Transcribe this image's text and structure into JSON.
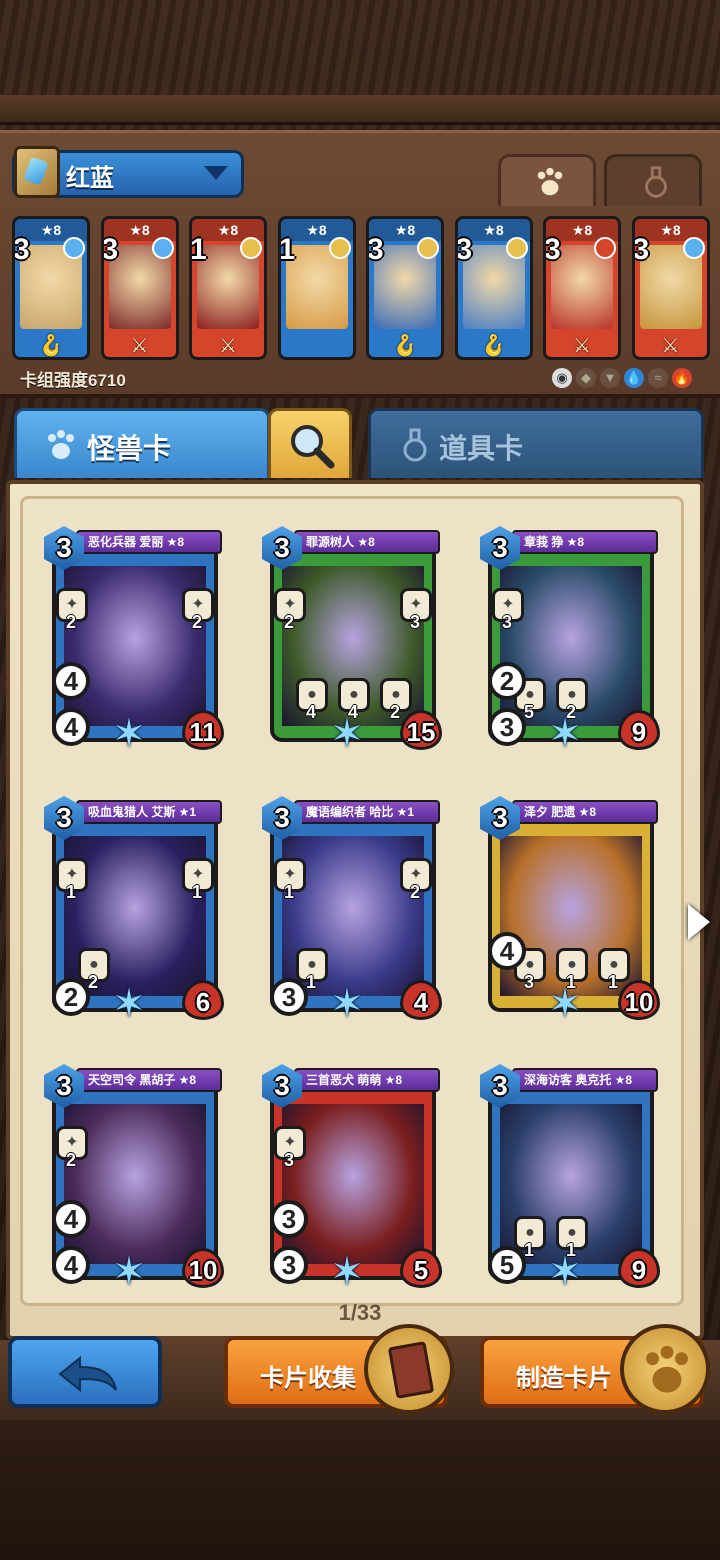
{
  "deck": {
    "name": "红蓝",
    "power_label": "卡组强度6710",
    "cards": [
      {
        "stars": "★8",
        "cost": "3",
        "color": "blue",
        "gem": "#5ab0f0",
        "art": "#c9a56a",
        "weapon": "🪝"
      },
      {
        "stars": "★8",
        "cost": "3",
        "color": "red",
        "gem": "#5ab0f0",
        "art": "#7c2a2a",
        "weapon": "⚔"
      },
      {
        "stars": "★8",
        "cost": "1",
        "color": "red",
        "gem": "#e5c04c",
        "art": "#8b1f1f",
        "weapon": "⚔"
      },
      {
        "stars": "★8",
        "cost": "1",
        "color": "blue",
        "gem": "#e5c04c",
        "art": "#d79a45",
        "weapon": ""
      },
      {
        "stars": "★8",
        "cost": "3",
        "color": "blue",
        "gem": "#e5c04c",
        "art": "#3a6bb8",
        "weapon": "🪝"
      },
      {
        "stars": "★8",
        "cost": "3",
        "color": "blue",
        "gem": "#e5c04c",
        "art": "#4b7ec4",
        "weapon": "🪝"
      },
      {
        "stars": "★8",
        "cost": "3",
        "color": "red",
        "gem": "#d5452c",
        "art": "#b9332a",
        "weapon": "⚔"
      },
      {
        "stars": "★8",
        "cost": "3",
        "color": "red",
        "gem": "#5ab0f0",
        "art": "#c4953a",
        "weapon": "⚔"
      }
    ]
  },
  "tabs": {
    "monster_label": "怪兽卡",
    "item_label": "道具卡"
  },
  "cards": [
    {
      "title": "恶化兵器 爱丽 ★8",
      "cost": "3",
      "dice": "4",
      "atk": "4",
      "hp": "11",
      "frame": "#2f74c0",
      "art": "#3b2a6e",
      "skill_nums": [
        "2",
        "2"
      ],
      "low_nums": []
    },
    {
      "title": "罪源树人 ★8",
      "cost": "3",
      "dice": "",
      "atk": "",
      "hp": "15",
      "frame": "#3b9a3a",
      "art": "#3e5a2a",
      "skill_nums": [
        "2",
        "3"
      ],
      "low_nums": [
        "4",
        "4",
        "2"
      ]
    },
    {
      "title": "章莪 狰 ★8",
      "cost": "3",
      "dice": "2",
      "atk": "3",
      "hp": "9",
      "frame": "#3b9a3a",
      "art": "#2a4b6a",
      "skill_nums": [
        "3"
      ],
      "low_nums": [
        "5",
        "2"
      ]
    },
    {
      "title": "吸血鬼猎人 艾斯 ★1",
      "cost": "3",
      "dice": "",
      "atk": "2",
      "hp": "6",
      "frame": "#2f74c0",
      "art": "#2a2060",
      "skill_nums": [
        "1",
        "1"
      ],
      "low_nums": [
        "2"
      ]
    },
    {
      "title": "魔语编织者 哈比 ★1",
      "cost": "3",
      "dice": "",
      "atk": "3",
      "hp": "4",
      "frame": "#2f74c0",
      "art": "#3a3a8a",
      "skill_nums": [
        "1",
        "2"
      ],
      "low_nums": [
        "1"
      ]
    },
    {
      "title": "泽夕 肥遗 ★8",
      "cost": "3",
      "dice": "4",
      "atk": "",
      "hp": "10",
      "frame": "#d8b035",
      "art": "#b8702a",
      "skill_nums": [],
      "low_nums": [
        "3",
        "1",
        "1"
      ]
    },
    {
      "title": "天空司令 黑胡子 ★8",
      "cost": "3",
      "dice": "4",
      "atk": "4",
      "hp": "10",
      "frame": "#2f74c0",
      "art": "#4a2a5a",
      "skill_nums": [
        "2"
      ],
      "low_nums": []
    },
    {
      "title": "三首恶犬 萌萌 ★8",
      "cost": "3",
      "dice": "3",
      "atk": "3",
      "hp": "5",
      "frame": "#c8342a",
      "art": "#7a1e1e",
      "skill_nums": [
        "3"
      ],
      "low_nums": []
    },
    {
      "title": "深海访客 奥克托 ★8",
      "cost": "3",
      "dice": "",
      "atk": "5",
      "hp": "9",
      "frame": "#2f74c0",
      "art": "#2a3f6a",
      "skill_nums": [],
      "low_nums": [
        "1",
        "1"
      ]
    }
  ],
  "pagination": {
    "label": "1/33"
  },
  "bottom": {
    "collect_label": "卡片收集",
    "craft_label": "制造卡片"
  }
}
